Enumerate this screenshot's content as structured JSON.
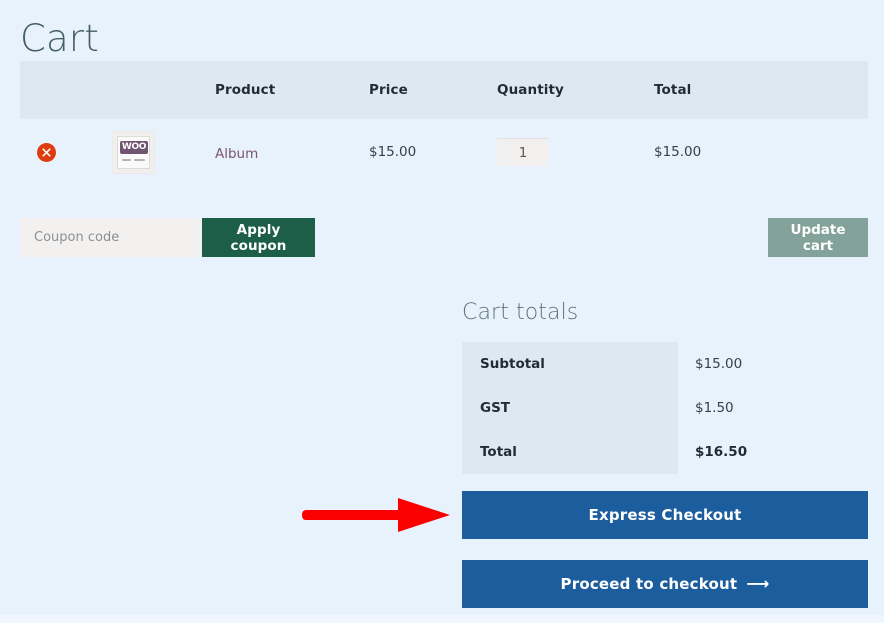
{
  "page": {
    "title": "Cart",
    "background_color": "#e8f2fc"
  },
  "cart_table": {
    "headers": {
      "remove": "",
      "thumbnail": "",
      "product": "Product",
      "price": "Price",
      "quantity": "Quantity",
      "total": "Total"
    },
    "rows": [
      {
        "remove_icon": "remove-circle-x-icon",
        "thumbnail_icon": "product-thumbnail-woo-album",
        "thumbnail_text": "WOO",
        "product": "Album",
        "price": "$15.00",
        "quantity": "1",
        "total": "$15.00"
      }
    ]
  },
  "actions": {
    "coupon_placeholder": "Coupon code",
    "coupon_value": "",
    "apply_coupon_label": "Apply coupon",
    "update_cart_label": "Update cart",
    "apply_coupon_color": "#1d5e48",
    "update_cart_color": "#83a39a"
  },
  "cart_totals": {
    "title": "Cart totals",
    "rows": [
      {
        "label": "Subtotal",
        "value": "$15.00"
      },
      {
        "label": "GST",
        "value": "$1.50"
      },
      {
        "label": "Total",
        "value": "$16.50"
      }
    ]
  },
  "checkout": {
    "express_label": "Express Checkout",
    "proceed_label": "Proceed to checkout",
    "proceed_arrow": "⟶",
    "button_color": "#1c5d9e"
  },
  "annotation": {
    "arrow_icon": "red-pointer-arrow-icon",
    "arrow_color": "#fb0000",
    "points_to": "Express Checkout"
  }
}
